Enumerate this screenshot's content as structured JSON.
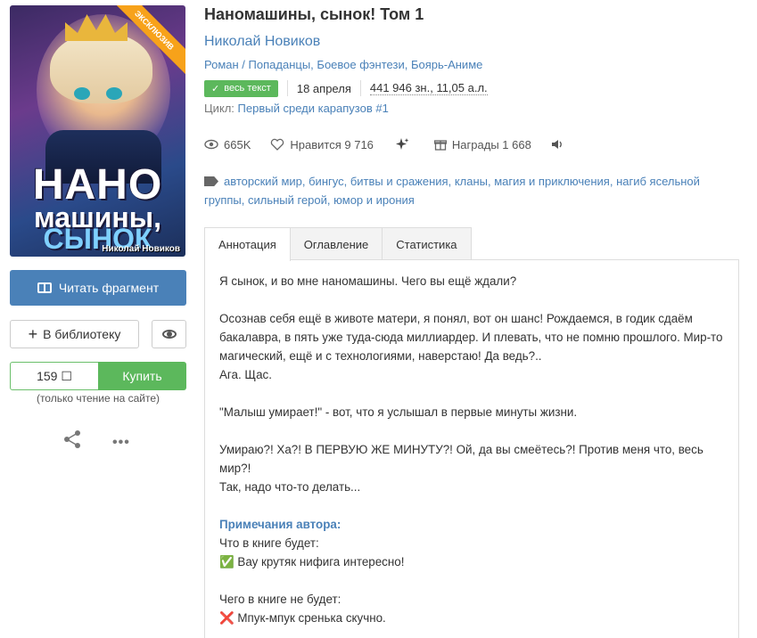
{
  "cover": {
    "ribbon": "ЭКСКЛЮЗИВ",
    "line1": "НАНО",
    "line2": "машины,",
    "line3": "СЫНОК",
    "author": "Николай Новиков"
  },
  "sidebar": {
    "read_label": "Читать фрагмент",
    "library_label": "В библиотеку",
    "price": "159 ☐",
    "buy_label": "Купить",
    "note": "(только чтение на сайте)"
  },
  "book": {
    "title": "Наномашины, сынок! Том 1",
    "author": "Николай Новиков",
    "genres": [
      "Роман",
      "Попаданцы",
      "Боевое фэнтези",
      "Боярь-Аниме"
    ],
    "status": "весь текст",
    "date": "18 апреля",
    "size": "441 946 зн., 11,05 а.л.",
    "cycle_label": "Цикл:",
    "cycle_value": "Первый среди карапузов #1"
  },
  "stats": {
    "views": "665K",
    "likes_label": "Нравится",
    "likes": "9 716",
    "awards_label": "Награды",
    "awards": "1 668"
  },
  "tags": [
    "авторский мир",
    "бингус",
    "битвы и сражения",
    "кланы",
    "магия и приключения",
    "нагиб ясельной группы",
    "сильный герой",
    "юмор и ирония"
  ],
  "tabs": [
    "Аннотация",
    "Оглавление",
    "Статистика"
  ],
  "annotation": {
    "p1": "Я сынок, и во мне наномашины. Чего вы ещё ждали?",
    "p2a": "Осознав себя ещё в животе матери, я понял, вот он шанс! Рождаемся, в годик сдаём бакалавра, в пять уже туда-сюда миллиардер. И плевать, что не помню прошлого. Мир-то магический, ещё и с технологиями, наверстаю! Да ведь?..",
    "p2b": "Ага. Щас.",
    "p3": "\"Малыш умирает!\" - вот, что я услышал в первые минуты жизни.",
    "p4a": "Умираю?! Ха?! В ПЕРВУЮ ЖЕ МИНУТУ?! Ой, да вы смеётесь?! Против меня что, весь мир?!",
    "p4b": "Так, надо что-то делать...",
    "notes_title": "Примечания автора:",
    "will_title": "Что в книге будет:",
    "will_item": "✅ Вау крутяк нифига интересно!",
    "wont_title": "Чего в книге не будет:",
    "wont_item": "❌ Мпук-мпук сренька скучно."
  }
}
